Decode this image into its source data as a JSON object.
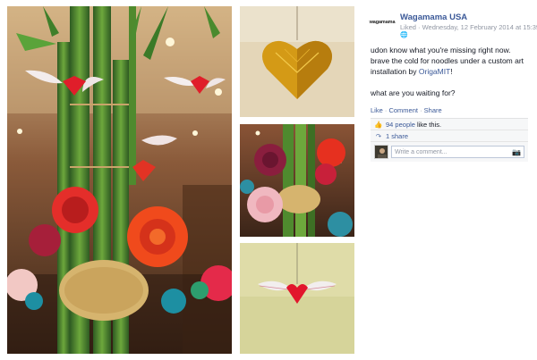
{
  "post": {
    "page_logo": "wagamama",
    "author": "Wagamama USA",
    "meta": "Liked · Wednesday, 12 February 2014 at 15:39",
    "audience_icon": "globe-icon",
    "message_part1": "udon know what you're missing right now. brave the cold for noodles under a custom art installation by ",
    "message_link": "OrigaMIT",
    "message_part2": "!",
    "message_line2": "what are you waiting for?"
  },
  "actions": {
    "like": "Like",
    "comment": "Comment",
    "share": "Share",
    "separator": "·"
  },
  "ufi": {
    "likes_link": "94 people",
    "likes_suffix": "like this.",
    "shares": "1 share",
    "comment_placeholder": "Write a comment...",
    "like_icon": "thumbs-up-icon",
    "share_icon": "share-icon",
    "camera_icon": "camera-icon"
  },
  "colors": {
    "link": "#3b5998",
    "meta": "#9197a3",
    "ufi_bg": "#f6f7f8"
  },
  "photos": [
    "photo-main",
    "photo-heart",
    "photo-cluster",
    "photo-winged"
  ]
}
